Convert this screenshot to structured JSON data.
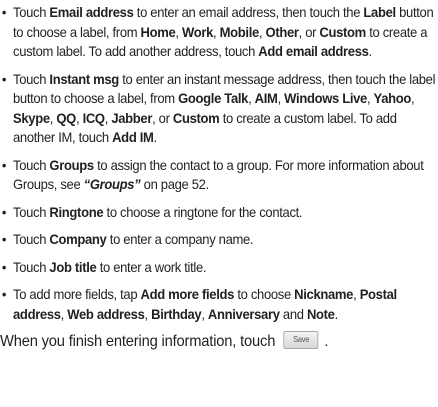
{
  "bullet_glyph": "•",
  "items": [
    {
      "id": "email",
      "parts": [
        {
          "t": "Touch "
        },
        {
          "t": "Email address",
          "b": true
        },
        {
          "t": " to enter an email address, then touch the "
        },
        {
          "t": "Label",
          "b": true
        },
        {
          "t": " button to choose a label, from "
        },
        {
          "t": "Home",
          "b": true
        },
        {
          "t": ", "
        },
        {
          "t": "Work",
          "b": true
        },
        {
          "t": ", "
        },
        {
          "t": "Mobile",
          "b": true
        },
        {
          "t": ", "
        },
        {
          "t": "Other",
          "b": true
        },
        {
          "t": ", or "
        },
        {
          "t": "Custom",
          "b": true
        },
        {
          "t": " to create a custom label. To add another address, touch "
        },
        {
          "t": "Add email address",
          "b": true
        },
        {
          "t": "."
        }
      ]
    },
    {
      "id": "instant-msg",
      "parts": [
        {
          "t": "Touch "
        },
        {
          "t": "Instant msg",
          "b": true
        },
        {
          "t": " to enter an instant message address, then touch the label button to choose a label, from "
        },
        {
          "t": "Google Talk",
          "b": true
        },
        {
          "t": ", "
        },
        {
          "t": "AIM",
          "b": true
        },
        {
          "t": ", "
        },
        {
          "t": "Windows Live",
          "b": true
        },
        {
          "t": ", "
        },
        {
          "t": "Yahoo",
          "b": true
        },
        {
          "t": ", "
        },
        {
          "t": "Skype",
          "b": true
        },
        {
          "t": ", "
        },
        {
          "t": "QQ",
          "b": true
        },
        {
          "t": ", "
        },
        {
          "t": "ICQ",
          "b": true
        },
        {
          "t": ", "
        },
        {
          "t": "Jabber",
          "b": true
        },
        {
          "t": ", or "
        },
        {
          "t": "Custom",
          "b": true
        },
        {
          "t": "  to create a custom label. To add another IM, touch "
        },
        {
          "t": "Add IM",
          "b": true
        },
        {
          "t": "."
        }
      ]
    },
    {
      "id": "groups",
      "parts": [
        {
          "t": "Touch "
        },
        {
          "t": "Groups",
          "b": true
        },
        {
          "t": " to assign the contact to a group. For more information about Groups, see "
        },
        {
          "t": "“Groups”",
          "b": true,
          "i": true
        },
        {
          "t": " on page 52."
        }
      ]
    },
    {
      "id": "ringtone",
      "parts": [
        {
          "t": "Touch "
        },
        {
          "t": "Ringtone",
          "b": true
        },
        {
          "t": " to choose a ringtone for the contact."
        }
      ]
    },
    {
      "id": "company",
      "parts": [
        {
          "t": "Touch "
        },
        {
          "t": "Company",
          "b": true
        },
        {
          "t": " to enter a company name."
        }
      ]
    },
    {
      "id": "job-title",
      "parts": [
        {
          "t": "Touch "
        },
        {
          "t": "Job title",
          "b": true
        },
        {
          "t": " to enter a work title."
        }
      ]
    },
    {
      "id": "more-fields",
      "parts": [
        {
          "t": "To add more fields, tap "
        },
        {
          "t": "Add more fields",
          "b": true
        },
        {
          "t": " to choose "
        },
        {
          "t": "Nickname",
          "b": true
        },
        {
          "t": ", "
        },
        {
          "t": "Postal address",
          "b": true
        },
        {
          "t": ", "
        },
        {
          "t": "Web address",
          "b": true
        },
        {
          "t": ", "
        },
        {
          "t": "Birthday",
          "b": true
        },
        {
          "t": ", "
        },
        {
          "t": "Anniversary",
          "b": true
        },
        {
          "t": " and "
        },
        {
          "t": "Note",
          "b": true
        },
        {
          "t": "."
        }
      ]
    }
  ],
  "footer": {
    "text_before": "When you finish entering information, touch",
    "save_button_label": "Save",
    "text_after": "."
  }
}
